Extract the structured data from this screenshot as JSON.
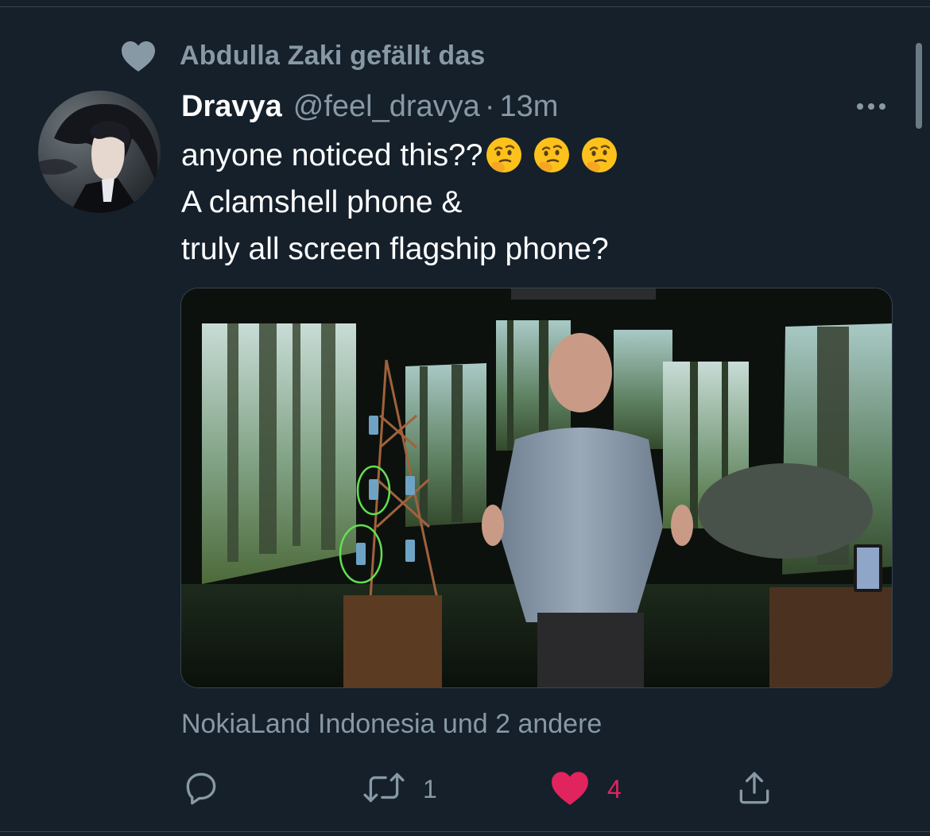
{
  "social_context": {
    "text": "Abdulla Zaki gefällt das",
    "icon": "heart-icon"
  },
  "tweet": {
    "author_name": "Dravya",
    "author_handle": "@feel_dravya",
    "separator": "·",
    "time": "13m",
    "text_lines": [
      "anyone noticed this??",
      "A clamshell phone &",
      "truly all screen flagship phone?"
    ],
    "emoji": "thinking-face-emoji",
    "media_alt": "video-still"
  },
  "likers_text": "NokiaLand Indonesia und 2 andere",
  "actions": {
    "reply_icon": "reply-icon",
    "retweet_icon": "retweet-icon",
    "retweet_count": "1",
    "like_icon": "heart-filled-icon",
    "like_count": "4",
    "share_icon": "share-icon"
  },
  "colors": {
    "background": "#15202b",
    "secondary_text": "#8899a6",
    "like": "#e0245e",
    "divider": "#38444d"
  }
}
